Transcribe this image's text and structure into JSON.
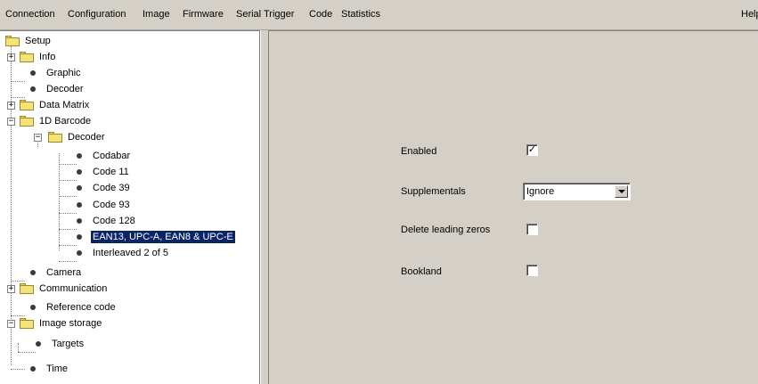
{
  "menu": {
    "connection": "Connection",
    "configuration": "Configuration",
    "image": "Image",
    "firmware": "Firmware",
    "serial_trigger": "Serial Trigger",
    "code": "Code",
    "statistics": "Statistics",
    "help": "Help"
  },
  "tree": {
    "setup": "Setup",
    "info": "Info",
    "graphic": "Graphic",
    "decoder": "Decoder",
    "data_matrix": "Data Matrix",
    "barcode_1d": "1D Barcode",
    "barcode_decoder": "Decoder",
    "codabar": "Codabar",
    "code11": "Code 11",
    "code39": "Code 39",
    "code93": "Code 93",
    "code128": "Code 128",
    "ean": "EAN13, UPC-A, EAN8 & UPC-E",
    "interleaved": "Interleaved 2 of 5",
    "camera": "Camera",
    "communication": "Communication",
    "reference_code": "Reference code",
    "image_storage": "Image storage",
    "targets": "Targets",
    "time": "Time",
    "selected": "EAN13, UPC-A, EAN8 & UPC-E"
  },
  "form": {
    "enabled_label": "Enabled",
    "enabled_checked": true,
    "supplementals_label": "Supplementals",
    "supplementals_value": "Ignore",
    "delete_zeros_label": "Delete leading zeros",
    "delete_zeros_checked": false,
    "bookland_label": "Bookland",
    "bookland_checked": false
  },
  "colors": {
    "selection": "#0a246a",
    "panel": "#d4d0c8",
    "folder": "#f7e27a"
  }
}
